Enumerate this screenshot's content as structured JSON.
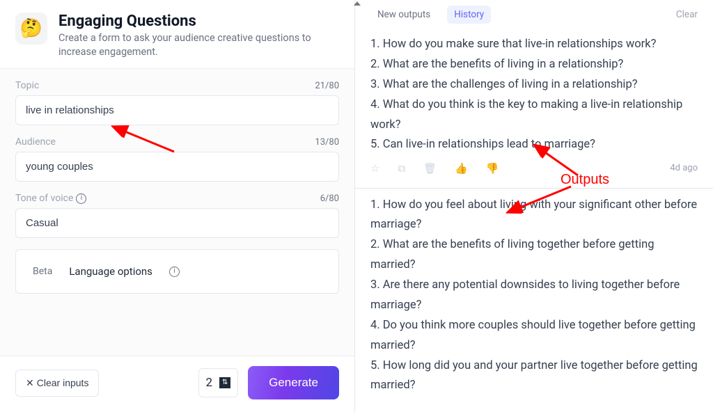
{
  "header": {
    "emoji": "🤔",
    "title": "Engaging Questions",
    "subtitle": "Create a form to ask your audience creative questions to increase engagement."
  },
  "form": {
    "topic": {
      "label": "Topic",
      "value": "live in relationships",
      "count": "21/80"
    },
    "audience": {
      "label": "Audience",
      "value": "young couples",
      "count": "13/80"
    },
    "tone": {
      "label": "Tone of voice",
      "value": "Casual",
      "count": "6/80"
    },
    "lang": {
      "beta": "Beta",
      "label": "Language options"
    }
  },
  "footer": {
    "clear": "Clear inputs",
    "qty": "2",
    "generate": "Generate"
  },
  "tabs": {
    "new": "New outputs",
    "history": "History",
    "clear": "Clear"
  },
  "outputs": {
    "block1": {
      "l1": "1. How do you make sure that live-in relationships work?",
      "l2": "2. What are the benefits of living in a relationship?",
      "l3": "3. What are the challenges of living in a relationship?",
      "l4": "4. What do you think is the key to making a live-in relationship work?",
      "l5": "5. Can live-in relationships lead to marriage?"
    },
    "timestamp": "4d ago",
    "block2": {
      "l1": "1. How do you feel about living with your significant other before marriage?",
      "l2": "2. What are the benefits of living together before getting married?",
      "l3": "3. Are there any potential downsides to living together before marriage?",
      "l4": "4. Do you think more couples should live together before getting married?",
      "l5": "5. How long did you and your partner live together before getting married?"
    }
  },
  "annotation": {
    "label": "Outputs"
  }
}
